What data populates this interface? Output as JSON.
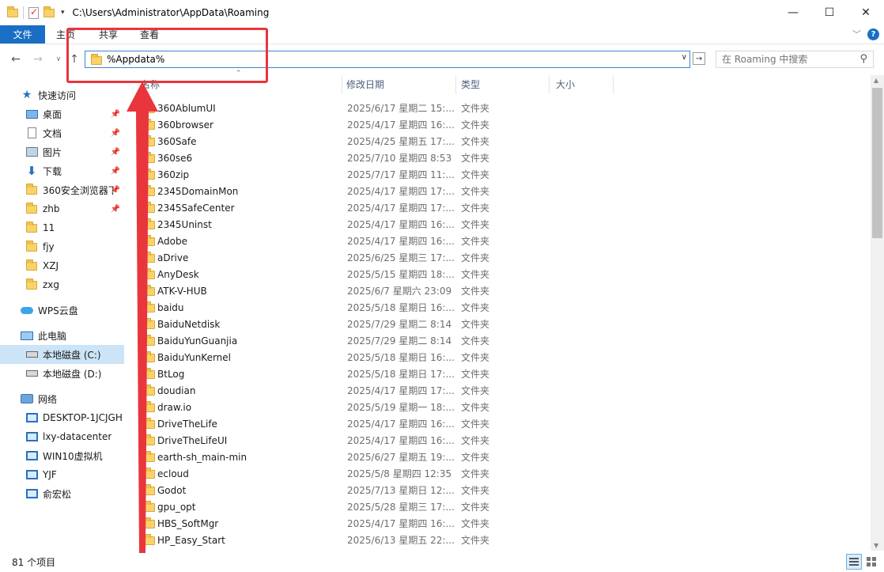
{
  "titlebar": {
    "path": "C:\\Users\\Administrator\\AppData\\Roaming",
    "minimize": "—",
    "maximize": "☐",
    "close": "✕"
  },
  "ribbon": {
    "file": "文件",
    "tabs": [
      "主页",
      "共享",
      "查看"
    ]
  },
  "address": {
    "value": "%Appdata%",
    "search_placeholder": "在 Roaming 中搜索"
  },
  "sidebar": {
    "quick_access": "快速访问",
    "quick_items": [
      {
        "label": "桌面",
        "icon": "desktop-icon",
        "pinned": true
      },
      {
        "label": "文档",
        "icon": "document-icon",
        "pinned": true
      },
      {
        "label": "图片",
        "icon": "pictures-icon",
        "pinned": true
      },
      {
        "label": "下载",
        "icon": "download-icon",
        "pinned": true
      },
      {
        "label": "360安全浏览器下",
        "icon": "folder-icon",
        "pinned": true
      },
      {
        "label": "zhb",
        "icon": "folder-icon",
        "pinned": true
      },
      {
        "label": "11",
        "icon": "folder-icon",
        "pinned": false
      },
      {
        "label": "fjy",
        "icon": "folder-icon",
        "pinned": false
      },
      {
        "label": "XZJ",
        "icon": "folder-icon",
        "pinned": false
      },
      {
        "label": "zxg",
        "icon": "folder-icon",
        "pinned": false
      }
    ],
    "wps": "WPS云盘",
    "this_pc": "此电脑",
    "drives": [
      {
        "label": "本地磁盘 (C:)",
        "selected": true
      },
      {
        "label": "本地磁盘 (D:)",
        "selected": false
      }
    ],
    "network": "网络",
    "network_items": [
      "DESKTOP-1JCJGH",
      "lxy-datacenter",
      "WIN10虚拟机",
      "YJF",
      "俞宏松"
    ]
  },
  "columns": {
    "name": "名称",
    "date": "修改日期",
    "type": "类型",
    "size": "大小"
  },
  "files": [
    {
      "name": "360AblumUI",
      "date": "2025/6/17 星期二 15:...",
      "type": "文件夹"
    },
    {
      "name": "360browser",
      "date": "2025/4/17 星期四 16:...",
      "type": "文件夹"
    },
    {
      "name": "360Safe",
      "date": "2025/4/25 星期五 17:...",
      "type": "文件夹"
    },
    {
      "name": "360se6",
      "date": "2025/7/10 星期四 8:53",
      "type": "文件夹"
    },
    {
      "name": "360zip",
      "date": "2025/7/17 星期四 11:...",
      "type": "文件夹"
    },
    {
      "name": "2345DomainMon",
      "date": "2025/4/17 星期四 17:...",
      "type": "文件夹"
    },
    {
      "name": "2345SafeCenter",
      "date": "2025/4/17 星期四 17:...",
      "type": "文件夹"
    },
    {
      "name": "2345Uninst",
      "date": "2025/4/17 星期四 16:...",
      "type": "文件夹"
    },
    {
      "name": "Adobe",
      "date": "2025/4/17 星期四 16:...",
      "type": "文件夹"
    },
    {
      "name": "aDrive",
      "date": "2025/6/25 星期三 17:...",
      "type": "文件夹"
    },
    {
      "name": "AnyDesk",
      "date": "2025/5/15 星期四 18:...",
      "type": "文件夹"
    },
    {
      "name": "ATK-V-HUB",
      "date": "2025/6/7 星期六 23:09",
      "type": "文件夹"
    },
    {
      "name": "baidu",
      "date": "2025/5/18 星期日 16:...",
      "type": "文件夹"
    },
    {
      "name": "BaiduNetdisk",
      "date": "2025/7/29 星期二 8:14",
      "type": "文件夹"
    },
    {
      "name": "BaiduYunGuanjia",
      "date": "2025/7/29 星期二 8:14",
      "type": "文件夹"
    },
    {
      "name": "BaiduYunKernel",
      "date": "2025/5/18 星期日 16:...",
      "type": "文件夹"
    },
    {
      "name": "BtLog",
      "date": "2025/5/18 星期日 17:...",
      "type": "文件夹"
    },
    {
      "name": "doudian",
      "date": "2025/4/17 星期四 17:...",
      "type": "文件夹"
    },
    {
      "name": "draw.io",
      "date": "2025/5/19 星期一 18:...",
      "type": "文件夹"
    },
    {
      "name": "DriveTheLife",
      "date": "2025/4/17 星期四 16:...",
      "type": "文件夹"
    },
    {
      "name": "DriveTheLifeUI",
      "date": "2025/4/17 星期四 16:...",
      "type": "文件夹"
    },
    {
      "name": "earth-sh_main-min",
      "date": "2025/6/27 星期五 19:...",
      "type": "文件夹"
    },
    {
      "name": "ecloud",
      "date": "2025/5/8 星期四 12:35",
      "type": "文件夹"
    },
    {
      "name": "Godot",
      "date": "2025/7/13 星期日 12:...",
      "type": "文件夹"
    },
    {
      "name": "gpu_opt",
      "date": "2025/5/28 星期三 17:...",
      "type": "文件夹"
    },
    {
      "name": "HBS_SoftMgr",
      "date": "2025/4/17 星期四 16:...",
      "type": "文件夹"
    },
    {
      "name": "HP_Easy_Start",
      "date": "2025/6/13 星期五 22:...",
      "type": "文件夹"
    }
  ],
  "status": {
    "count": "81 个项目"
  },
  "colors": {
    "accent": "#1a6fc4",
    "annotation": "#e8363c",
    "selected_bg": "#cce4f7",
    "folder": "#f9d36a"
  }
}
